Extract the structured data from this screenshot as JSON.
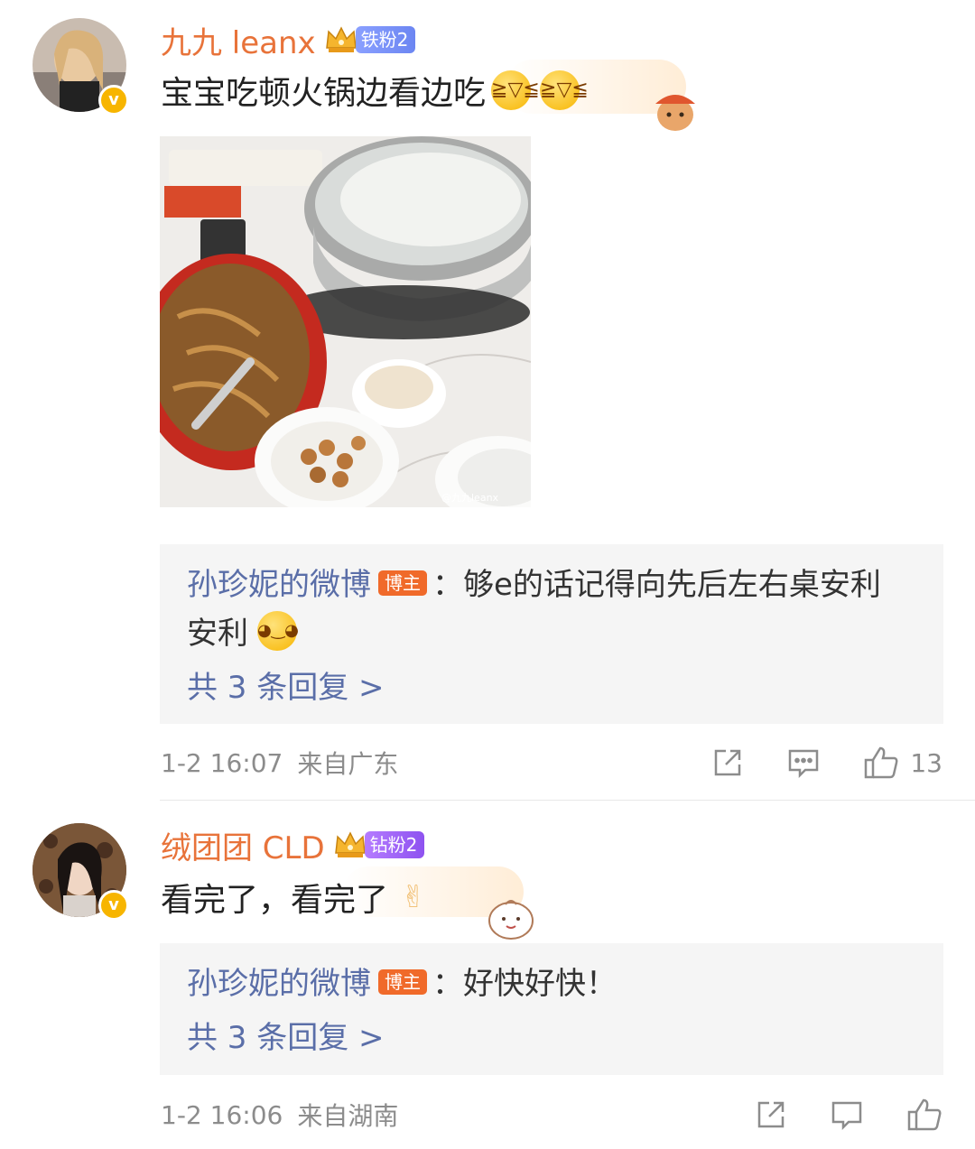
{
  "comments": [
    {
      "username": "九九 leanx",
      "fan_badge": "铁粉2",
      "text": "宝宝吃顿火锅边看边吃",
      "reply": {
        "author": "孙珍妮的微博",
        "host_label": "博主",
        "text": "：够e的话记得向先后左右桌安利",
        "text_cont": "安利",
        "more": "共 3 条回复 >"
      },
      "time": "1-2 16:07",
      "location": "来自广东",
      "likes": "13",
      "photo_watermark": "@九九leanx"
    },
    {
      "username": "绒团团 CLD",
      "fan_badge": "钻粉2",
      "text": "看完了，看完了",
      "reply": {
        "author": "孙珍妮的微博",
        "host_label": "博主",
        "text": "：好快好快！",
        "more": "共 3 条回复 >"
      },
      "time": "1-2 16:06",
      "location": "来自湖南"
    }
  ],
  "icons": [
    "share-icon",
    "comment-icon",
    "like-icon",
    "verified-icon",
    "crown-icon"
  ],
  "colors": {
    "username": "#e8733a",
    "reply_author": "#5a6ea8",
    "host_badge": "#f06a2a",
    "iron_badge": "#7a90f7",
    "diamond_badge": "#a066f8",
    "verified": "#f7b500"
  }
}
